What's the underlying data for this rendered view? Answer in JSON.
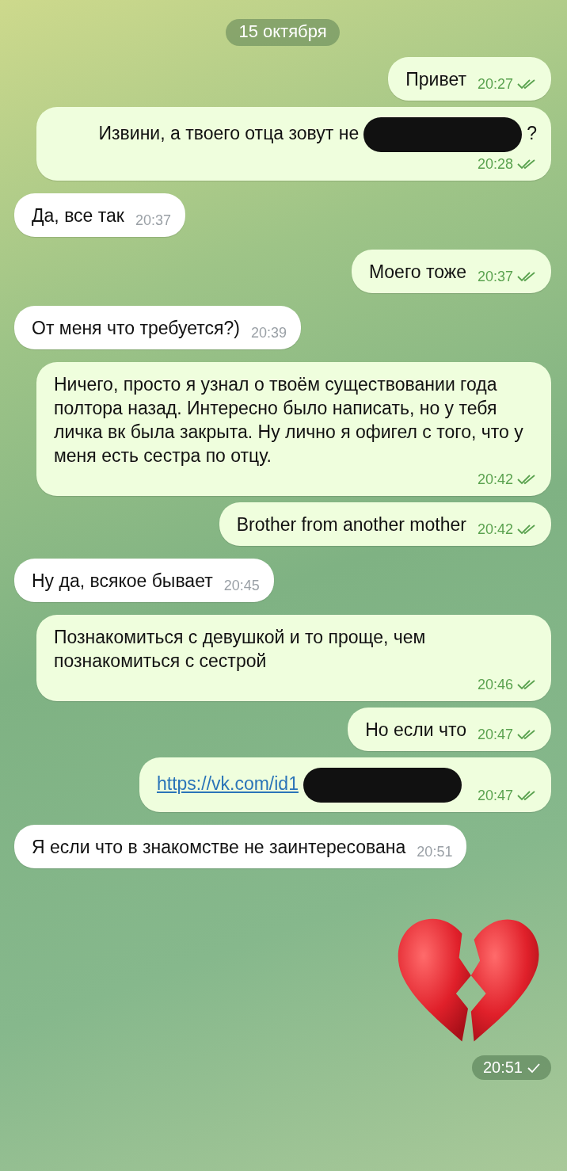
{
  "date_pill": "15 октября",
  "messages": [
    {
      "kind": "out",
      "parts": [
        {
          "kind": "text",
          "text": "Привет"
        }
      ],
      "time": "20:27",
      "read": true
    },
    {
      "kind": "out",
      "parts": [
        {
          "kind": "text",
          "text": "Извини, а твоего отца зовут не"
        },
        {
          "kind": "redacted"
        },
        {
          "kind": "text",
          "text": "?"
        }
      ],
      "time": "20:28",
      "read": true
    },
    {
      "kind": "in",
      "parts": [
        {
          "kind": "text",
          "text": "Да, все так"
        }
      ],
      "time": "20:37"
    },
    {
      "kind": "out",
      "parts": [
        {
          "kind": "text",
          "text": "Моего тоже"
        }
      ],
      "time": "20:37",
      "read": true
    },
    {
      "kind": "in",
      "parts": [
        {
          "kind": "text",
          "text": "От меня что требуется?)"
        }
      ],
      "time": "20:39"
    },
    {
      "kind": "out",
      "parts": [
        {
          "kind": "text",
          "text": "Ничего, просто я узнал о твоём существовании года полтора назад. Интересно было написать, но у тебя личка вк была закрыта. Ну лично я офигел с того, что у меня есть сестра по отцу."
        }
      ],
      "time": "20:42",
      "read": true
    },
    {
      "kind": "out",
      "parts": [
        {
          "kind": "text",
          "text": "Brother from another mother"
        }
      ],
      "time": "20:42",
      "read": true
    },
    {
      "kind": "in",
      "parts": [
        {
          "kind": "text",
          "text": "Ну да, всякое бывает"
        }
      ],
      "time": "20:45"
    },
    {
      "kind": "out",
      "parts": [
        {
          "kind": "text",
          "text": "Познакомиться с девушкой и то проще, чем познакомиться с сестрой"
        }
      ],
      "time": "20:46",
      "read": true
    },
    {
      "kind": "out",
      "parts": [
        {
          "kind": "text",
          "text": "Но если что"
        }
      ],
      "time": "20:47",
      "read": true
    },
    {
      "kind": "out",
      "parts": [
        {
          "kind": "link",
          "text": "https://vk.com/id1"
        },
        {
          "kind": "redacted"
        }
      ],
      "time": "20:47",
      "read": true
    },
    {
      "kind": "in",
      "parts": [
        {
          "kind": "text",
          "text": "Я если что в знакомстве не заинтересована"
        }
      ],
      "time": "20:51"
    },
    {
      "kind": "sticker",
      "time": "20:51",
      "read": false
    }
  ]
}
